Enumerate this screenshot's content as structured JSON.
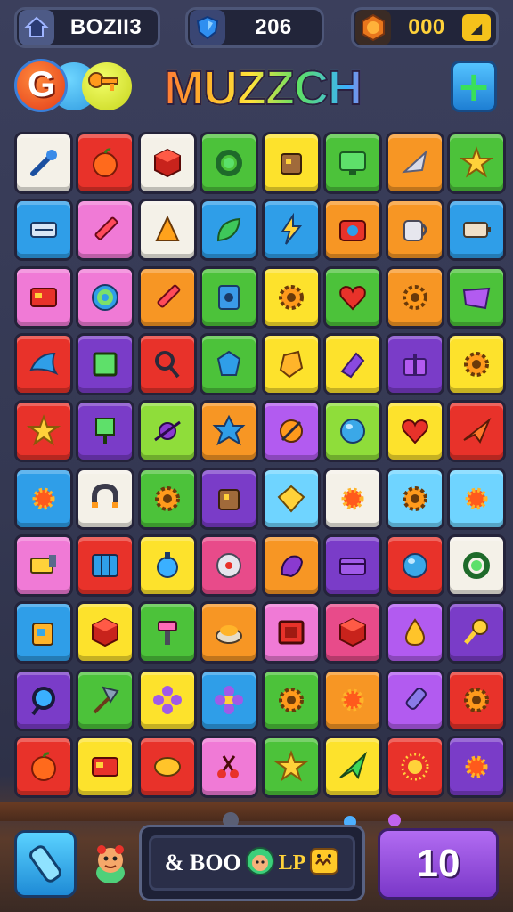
{
  "topbar": {
    "level": {
      "value": "BOZII3",
      "icon": "home-icon"
    },
    "gems": {
      "value": "206",
      "icon": "shield-gem-icon"
    },
    "coins": {
      "value": "000",
      "icon": "coin-icon",
      "badge": "◢"
    }
  },
  "header": {
    "title": "MUZZCH",
    "logo_letter": "G",
    "add_label": "+"
  },
  "colors": {
    "red": "#e8322a",
    "orange": "#f79624",
    "yellow": "#fde22c",
    "green": "#4cc23a",
    "lime": "#8fdd3a",
    "blue": "#2f9ee8",
    "sky": "#6fd4ff",
    "purple": "#7a3cc8",
    "violet": "#b25bf0",
    "pink": "#f07ad6",
    "magenta": "#e84b8a",
    "white": "#f4f1e8"
  },
  "board": {
    "rows": [
      [
        [
          "white",
          "wand-icon"
        ],
        [
          "red",
          "apple-icon"
        ],
        [
          "white",
          "cube-icon"
        ],
        [
          "green",
          "ring-icon"
        ],
        [
          "yellow",
          "box-icon"
        ],
        [
          "green",
          "monitor-icon"
        ],
        [
          "orange",
          "rocket-icon"
        ],
        [
          "green",
          "star-icon"
        ]
      ],
      [
        [
          "blue",
          "keyboard-icon"
        ],
        [
          "pink",
          "pencil-icon"
        ],
        [
          "white",
          "cone-icon"
        ],
        [
          "blue",
          "leaf-icon"
        ],
        [
          "blue",
          "lightning-icon"
        ],
        [
          "orange",
          "camera-icon"
        ],
        [
          "orange",
          "mug-icon"
        ],
        [
          "blue",
          "battery-icon"
        ]
      ],
      [
        [
          "pink",
          "card-icon"
        ],
        [
          "pink",
          "target-icon"
        ],
        [
          "orange",
          "pencil-icon"
        ],
        [
          "green",
          "panel-icon"
        ],
        [
          "yellow",
          "gear-icon"
        ],
        [
          "green",
          "heart-icon"
        ],
        [
          "orange",
          "gear-icon"
        ],
        [
          "green",
          "envelope-icon"
        ]
      ],
      [
        [
          "red",
          "bird-icon"
        ],
        [
          "purple",
          "square-icon"
        ],
        [
          "red",
          "magnifier-icon"
        ],
        [
          "green",
          "gem-icon"
        ],
        [
          "yellow",
          "crystal-icon"
        ],
        [
          "yellow",
          "prism-icon"
        ],
        [
          "purple",
          "gift-icon"
        ],
        [
          "yellow",
          "gear-icon"
        ]
      ],
      [
        [
          "red",
          "star-icon"
        ],
        [
          "purple",
          "flag-icon"
        ],
        [
          "lime",
          "bug-icon"
        ],
        [
          "orange",
          "splat-icon"
        ],
        [
          "violet",
          "compass-icon"
        ],
        [
          "lime",
          "orb-icon"
        ],
        [
          "yellow",
          "heart-icon"
        ],
        [
          "red",
          "plane-icon"
        ]
      ],
      [
        [
          "blue",
          "sun-icon"
        ],
        [
          "white",
          "magnet-icon"
        ],
        [
          "green",
          "gear-icon"
        ],
        [
          "purple",
          "box-icon"
        ],
        [
          "sky",
          "kite-icon"
        ],
        [
          "white",
          "sun-icon"
        ],
        [
          "sky",
          "gear-icon"
        ],
        [
          "sky",
          "sun-icon"
        ]
      ],
      [
        [
          "pink",
          "ticket-icon"
        ],
        [
          "red",
          "grid-icon"
        ],
        [
          "yellow",
          "potion-icon"
        ],
        [
          "magenta",
          "cd-icon"
        ],
        [
          "orange",
          "hand-icon"
        ],
        [
          "purple",
          "chest-icon"
        ],
        [
          "red",
          "orb-icon"
        ],
        [
          "white",
          "ring-icon"
        ]
      ],
      [
        [
          "blue",
          "bag-icon"
        ],
        [
          "yellow",
          "cube-icon"
        ],
        [
          "green",
          "hammer-icon"
        ],
        [
          "orange",
          "cake-icon"
        ],
        [
          "pink",
          "frame-icon"
        ],
        [
          "magenta",
          "cube-icon"
        ],
        [
          "violet",
          "drop-icon"
        ],
        [
          "purple",
          "key-icon"
        ]
      ],
      [
        [
          "purple",
          "lens-icon"
        ],
        [
          "green",
          "shovel-icon"
        ],
        [
          "yellow",
          "flower-icon"
        ],
        [
          "blue",
          "flower-icon"
        ],
        [
          "green",
          "gear-icon"
        ],
        [
          "orange",
          "sun-icon"
        ],
        [
          "violet",
          "bolt-icon"
        ],
        [
          "red",
          "gear-icon"
        ]
      ],
      [
        [
          "red",
          "apple-icon"
        ],
        [
          "yellow",
          "card-icon"
        ],
        [
          "red",
          "bean-icon"
        ],
        [
          "pink",
          "scissors-icon"
        ],
        [
          "green",
          "star-icon"
        ],
        [
          "yellow",
          "arrow-icon"
        ],
        [
          "red",
          "burst-icon"
        ],
        [
          "purple",
          "sun-icon"
        ]
      ]
    ]
  },
  "bottom": {
    "combo_text": "& BOO",
    "combo_text2": "LP",
    "moves": "10"
  }
}
